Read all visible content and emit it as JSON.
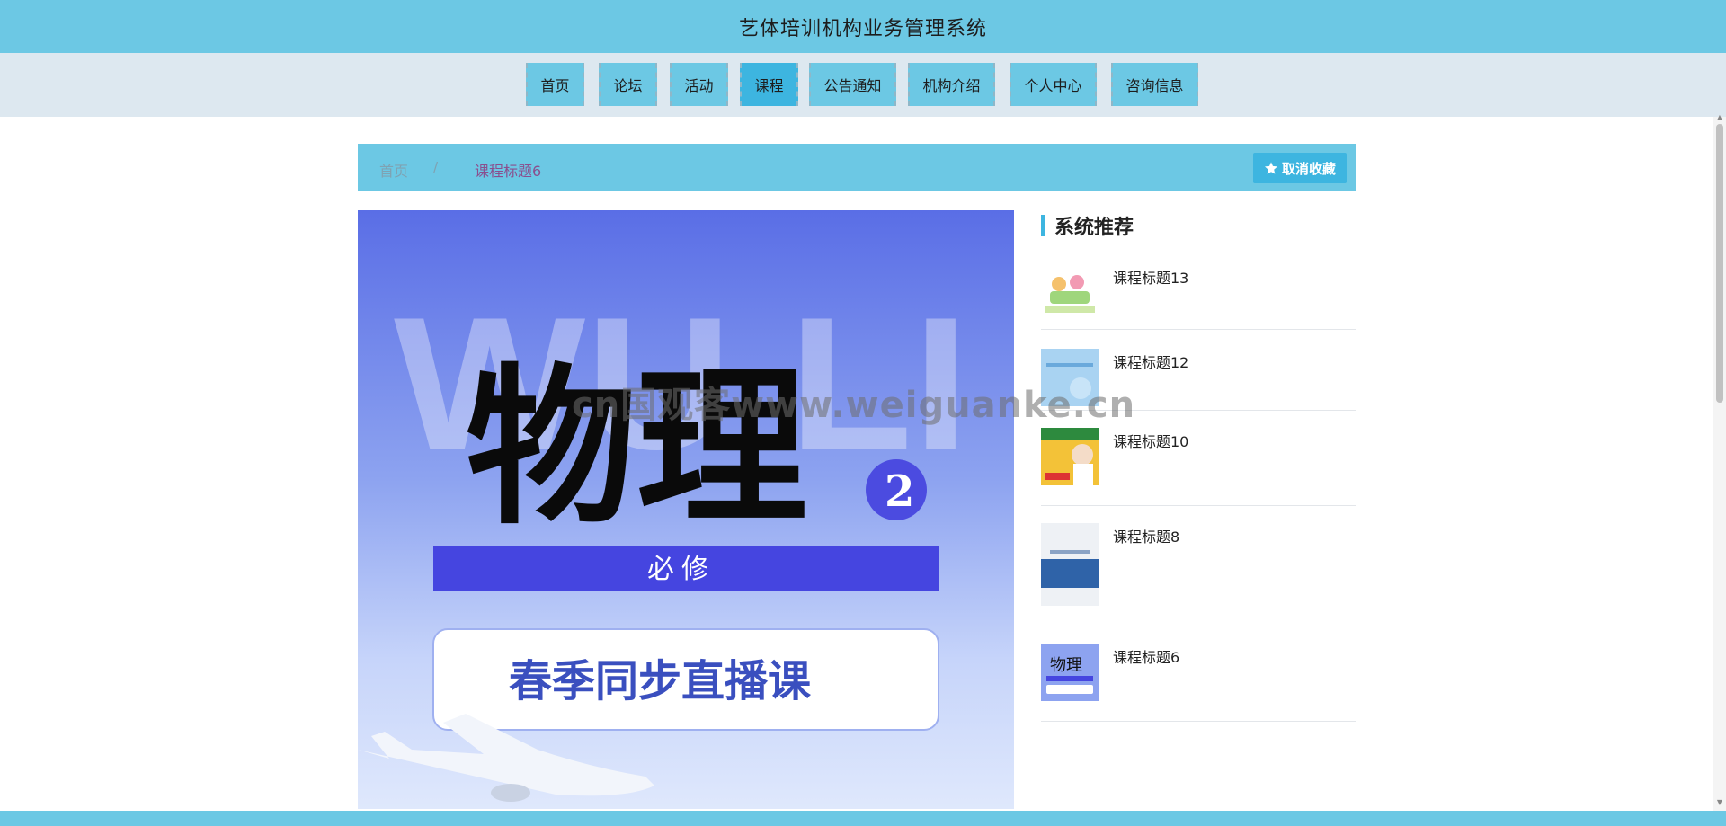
{
  "header": {
    "title": "艺体培训机构业务管理系统"
  },
  "nav": {
    "items": [
      {
        "label": "首页"
      },
      {
        "label": "论坛"
      },
      {
        "label": "活动"
      },
      {
        "label": "课程"
      },
      {
        "label": "公告通知"
      },
      {
        "label": "机构介绍"
      },
      {
        "label": "个人中心"
      },
      {
        "label": "咨询信息"
      }
    ],
    "active": "课程"
  },
  "breadcrumb": {
    "home": "首页",
    "separator": "/",
    "current": "课程标题6"
  },
  "favorite_button": {
    "label": "取消收藏",
    "icon": "star-icon"
  },
  "main_image": {
    "bg_letters": "WU LI",
    "title": "物理",
    "badge": "2",
    "band": "必修",
    "card": "春季同步直播课"
  },
  "recommend": {
    "title": "系统推荐",
    "items": [
      {
        "name": "课程标题13"
      },
      {
        "name": "课程标题12"
      },
      {
        "name": "课程标题10"
      },
      {
        "name": "课程标题8"
      },
      {
        "name": "课程标题6"
      }
    ]
  },
  "watermark": "cn国观客www.weiguanke.cn",
  "colors": {
    "primary": "#6cc8e4",
    "active": "#3db5e0",
    "nav_bg": "#dde8f0"
  }
}
